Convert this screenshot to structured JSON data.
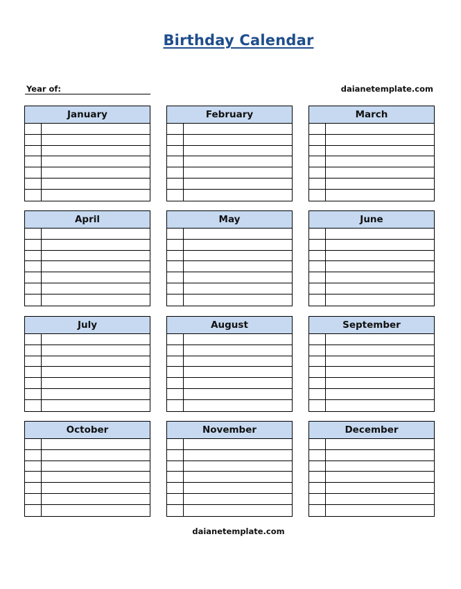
{
  "title": "Birthday Calendar",
  "year_label": "Year of:",
  "year_value": "",
  "site_top": "daianetemplate.com",
  "site_bottom": "daianetemplate.com",
  "rows_per_month": 7,
  "colors": {
    "title": "#1f4e8c",
    "header_fill": "#c6d9f1",
    "border": "#000000"
  },
  "months": [
    {
      "name": "January"
    },
    {
      "name": "February"
    },
    {
      "name": "March"
    },
    {
      "name": "April"
    },
    {
      "name": "May"
    },
    {
      "name": "June"
    },
    {
      "name": "July"
    },
    {
      "name": "August"
    },
    {
      "name": "September"
    },
    {
      "name": "October"
    },
    {
      "name": "November"
    },
    {
      "name": "December"
    }
  ]
}
